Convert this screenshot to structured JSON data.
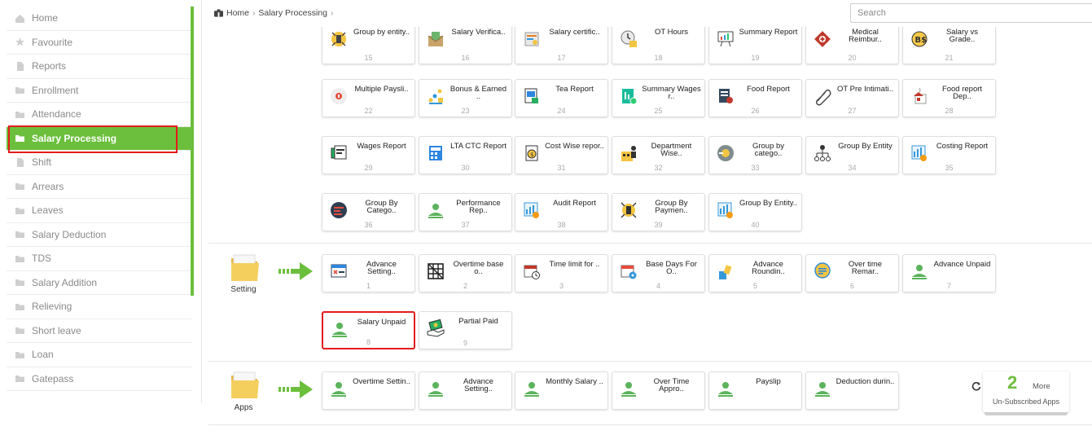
{
  "sidebar": {
    "items": [
      {
        "label": "Home",
        "icon": "home-icon"
      },
      {
        "label": "Favourite",
        "icon": "star-icon"
      },
      {
        "label": "Reports",
        "icon": "file-icon"
      },
      {
        "label": "Enrollment",
        "icon": "folder-icon"
      },
      {
        "label": "Attendance",
        "icon": "folder-icon"
      },
      {
        "label": "Salary Processing",
        "icon": "folder-icon",
        "active": true
      },
      {
        "label": "Shift",
        "icon": "file-icon"
      },
      {
        "label": "Arrears",
        "icon": "folder-icon"
      },
      {
        "label": "Leaves",
        "icon": "folder-icon"
      },
      {
        "label": "Salary Deduction",
        "icon": "folder-icon"
      },
      {
        "label": "TDS",
        "icon": "folder-icon"
      },
      {
        "label": "Salary Addition",
        "icon": "folder-icon"
      },
      {
        "label": "Relieving",
        "icon": "folder-icon"
      },
      {
        "label": "Short leave",
        "icon": "folder-icon"
      },
      {
        "label": "Loan",
        "icon": "folder-icon"
      },
      {
        "label": "Gatepass",
        "icon": "folder-icon"
      }
    ]
  },
  "breadcrumb": {
    "home": "Home",
    "current": "Salary Processing"
  },
  "search": {
    "placeholder": "Search"
  },
  "groups": {
    "setting": {
      "label": "Setting"
    },
    "apps": {
      "label": "Apps"
    }
  },
  "reports": [
    {
      "label": "Group by entity..",
      "num": "15",
      "icon": "group-entity-icon"
    },
    {
      "label": "Salary Verifica..",
      "num": "16",
      "icon": "envelope-money-icon"
    },
    {
      "label": "Salary certific..",
      "num": "17",
      "icon": "certificate-icon"
    },
    {
      "label": "OT Hours",
      "num": "18",
      "icon": "clock-icon"
    },
    {
      "label": "Summary Report",
      "num": "19",
      "icon": "presentation-icon"
    },
    {
      "label": "Medical Reimbur..",
      "num": "20",
      "icon": "medical-icon"
    },
    {
      "label": "Salary vs Grade..",
      "num": "21",
      "icon": "bitcoin-icon"
    },
    {
      "label": "Multiple Paysli..",
      "num": "22",
      "icon": "payslip-icon"
    },
    {
      "label": "Bonus & Earned ..",
      "num": "23",
      "icon": "bonus-chart-icon"
    },
    {
      "label": "Tea Report",
      "num": "24",
      "icon": "tea-report-icon"
    },
    {
      "label": "Summary Wages r..",
      "num": "25",
      "icon": "wages-summary-icon"
    },
    {
      "label": "Food Report",
      "num": "26",
      "icon": "food-report-icon"
    },
    {
      "label": "OT Pre Intimati..",
      "num": "27",
      "icon": "paperclip-icon"
    },
    {
      "label": "Food report Dep..",
      "num": "28",
      "icon": "food-dept-icon"
    },
    {
      "label": "Wages Report",
      "num": "29",
      "icon": "wages-icon"
    },
    {
      "label": "LTA CTC Report",
      "num": "30",
      "icon": "calculator-doc-icon"
    },
    {
      "label": "Cost Wise repor..",
      "num": "31",
      "icon": "cost-icon"
    },
    {
      "label": "Department Wise..",
      "num": "32",
      "icon": "department-icon"
    },
    {
      "label": "Group by catego..",
      "num": "33",
      "icon": "category-icon"
    },
    {
      "label": "Group By Entity",
      "num": "34",
      "icon": "hierarchy-icon"
    },
    {
      "label": "Costing Report",
      "num": "35",
      "icon": "costing-chart-icon"
    },
    {
      "label": "Group By Catego..",
      "num": "36",
      "icon": "category-dark-icon"
    },
    {
      "label": "Performance Rep..",
      "num": "37",
      "icon": "person-icon"
    },
    {
      "label": "Audit Report",
      "num": "38",
      "icon": "audit-chart-icon"
    },
    {
      "label": "Group By Paymen..",
      "num": "39",
      "icon": "payment-group-icon"
    },
    {
      "label": "Group By Entity..",
      "num": "40",
      "icon": "entity-chart-icon"
    }
  ],
  "settings": [
    {
      "label": "Advance Setting..",
      "num": "1",
      "icon": "advance-setting-icon"
    },
    {
      "label": "Overtime base o..",
      "num": "2",
      "icon": "grid-icon"
    },
    {
      "label": "Time limit for ..",
      "num": "3",
      "icon": "calendar-clock-icon"
    },
    {
      "label": "Base Days For O..",
      "num": "4",
      "icon": "calendar-gear-icon"
    },
    {
      "label": "Advance Roundin..",
      "num": "5",
      "icon": "hand-icon"
    },
    {
      "label": "Over time Remar..",
      "num": "6",
      "icon": "chat-icon"
    },
    {
      "label": "Advance Unpaid",
      "num": "7",
      "icon": "person-icon"
    },
    {
      "label": "Salary Unpaid",
      "num": "8",
      "icon": "person-icon",
      "highlight": true
    },
    {
      "label": "Partial Paid",
      "num": "9",
      "icon": "money-hand-icon"
    }
  ],
  "apps": [
    {
      "label": "Overtime Settin..",
      "icon": "person-icon"
    },
    {
      "label": "Advance Setting..",
      "icon": "person-icon"
    },
    {
      "label": "Monthly Salary ..",
      "icon": "person-icon"
    },
    {
      "label": "Over Time Appro..",
      "icon": "person-icon"
    },
    {
      "label": "Payslip",
      "icon": "person-icon"
    },
    {
      "label": "Deduction durin..",
      "icon": "person-icon"
    }
  ],
  "more": {
    "count": "2",
    "label": "More",
    "sub": "Un-Subscribed Apps"
  },
  "colors": {
    "accent": "#6cbf3c",
    "highlight": "#e31b1b"
  }
}
